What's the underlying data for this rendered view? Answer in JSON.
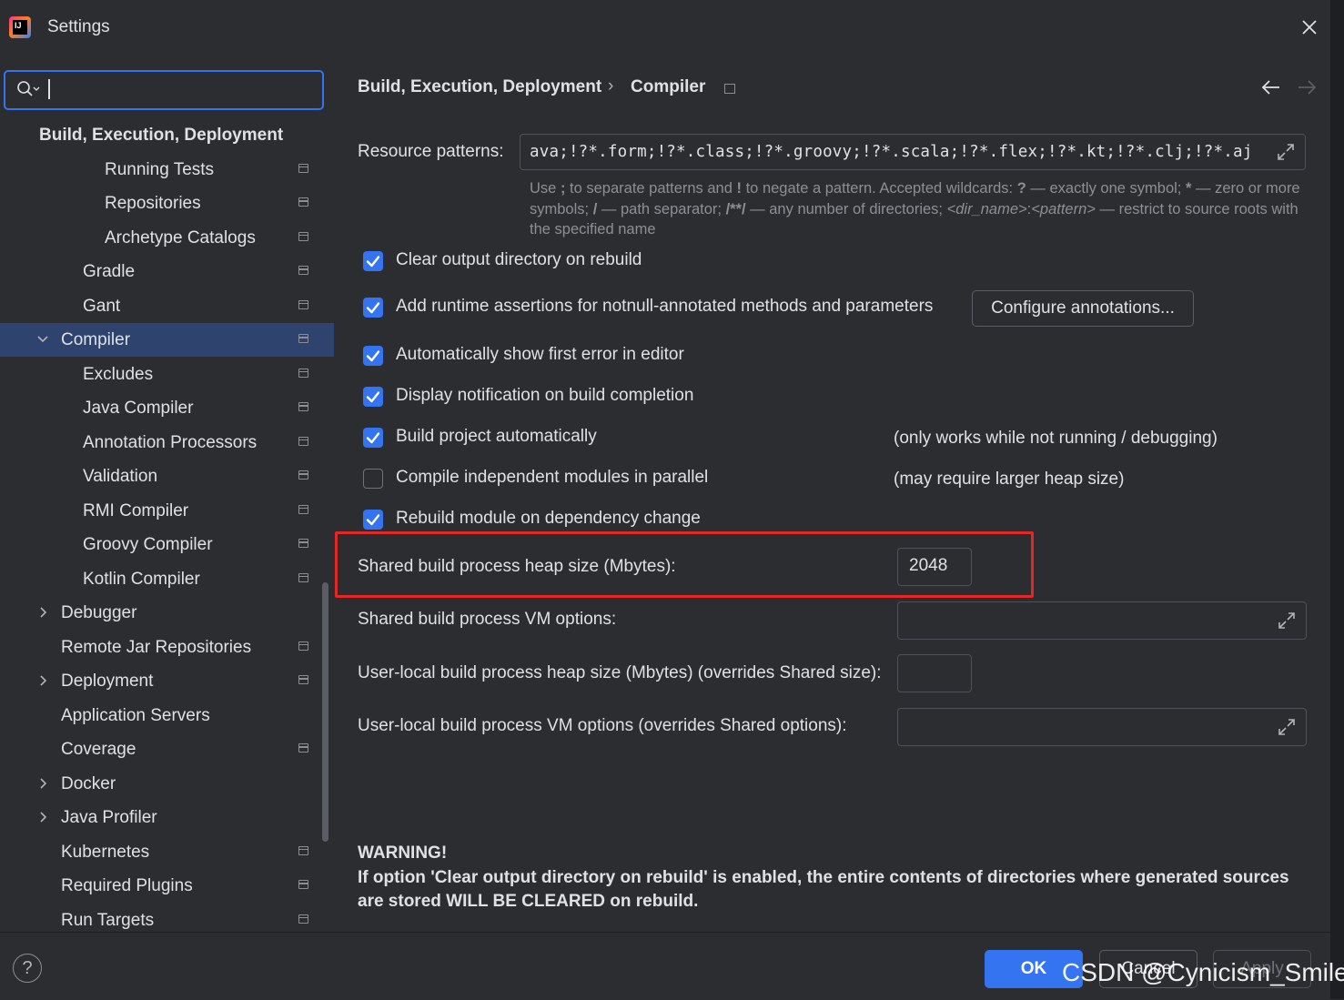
{
  "window": {
    "title": "Settings",
    "icons": {
      "app": "intellij-logo-icon",
      "close": "close-icon"
    }
  },
  "sidebar": {
    "search": {
      "value": "",
      "icon": "search-icon"
    },
    "items": [
      {
        "label": "Build, Execution, Deployment",
        "level": 0,
        "header": true
      },
      {
        "label": "Running Tests",
        "level": 3,
        "page_icon": true
      },
      {
        "label": "Repositories",
        "level": 3,
        "page_icon": true
      },
      {
        "label": "Archetype Catalogs",
        "level": 3,
        "page_icon": true
      },
      {
        "label": "Gradle",
        "level": 2,
        "page_icon": true
      },
      {
        "label": "Gant",
        "level": 2,
        "page_icon": true
      },
      {
        "label": "Compiler",
        "level": 1,
        "expanded": true,
        "selected": true,
        "page_icon": true
      },
      {
        "label": "Excludes",
        "level": 2,
        "page_icon": true
      },
      {
        "label": "Java Compiler",
        "level": 2,
        "page_icon": true
      },
      {
        "label": "Annotation Processors",
        "level": 2,
        "page_icon": true
      },
      {
        "label": "Validation",
        "level": 2,
        "page_icon": true
      },
      {
        "label": "RMI Compiler",
        "level": 2,
        "page_icon": true
      },
      {
        "label": "Groovy Compiler",
        "level": 2,
        "page_icon": true
      },
      {
        "label": "Kotlin Compiler",
        "level": 2,
        "page_icon": true
      },
      {
        "label": "Debugger",
        "level": 1,
        "collapsed": true
      },
      {
        "label": "Remote Jar Repositories",
        "level": 1,
        "page_icon": true
      },
      {
        "label": "Deployment",
        "level": 1,
        "collapsed": true,
        "page_icon": true
      },
      {
        "label": "Application Servers",
        "level": 1
      },
      {
        "label": "Coverage",
        "level": 1,
        "page_icon": true
      },
      {
        "label": "Docker",
        "level": 1,
        "collapsed": true
      },
      {
        "label": "Java Profiler",
        "level": 1,
        "collapsed": true
      },
      {
        "label": "Kubernetes",
        "level": 1,
        "page_icon": true
      },
      {
        "label": "Required Plugins",
        "level": 1,
        "page_icon": true
      },
      {
        "label": "Run Targets",
        "level": 1,
        "page_icon": true
      }
    ]
  },
  "breadcrumb": {
    "parent": "Build, Execution, Deployment",
    "separator": "›",
    "current": "Compiler",
    "back_icon": "arrow-left-icon",
    "forward_icon": "arrow-right-icon"
  },
  "resource_patterns": {
    "label": "Resource patterns:",
    "value": "ava;!?*.form;!?*.class;!?*.groovy;!?*.scala;!?*.flex;!?*.kt;!?*.clj;!?*.aj",
    "help_1": "Use",
    "help_2": ";",
    "help_3": "to separate patterns and",
    "help_4": "!",
    "help_5": "to negate a pattern. Accepted wildcards:",
    "help_6": "?",
    "help_7": "— exactly one symbol;",
    "help_8": "*",
    "help_9": "— zero or more symbols;",
    "help_10": "/",
    "help_11": "— path separator;",
    "help_12": "/**/",
    "help_13": "— any number of directories;",
    "help_14": "<dir_name>",
    "help_15": ":",
    "help_16": "<pattern>",
    "help_17": "— restrict to source roots with the specified name"
  },
  "options": [
    {
      "label": "Clear output directory on rebuild",
      "checked": true
    },
    {
      "label": "Add runtime assertions for notnull-annotated methods and parameters",
      "checked": true
    },
    {
      "label": "Automatically show first error in editor",
      "checked": true
    },
    {
      "label": "Display notification on build completion",
      "checked": true
    },
    {
      "label": "Build project automatically",
      "checked": true,
      "note": "(only works while not running / debugging)"
    },
    {
      "label": "Compile independent modules in parallel",
      "checked": false,
      "note": "(may require larger heap size)"
    },
    {
      "label": "Rebuild module on dependency change",
      "checked": true
    }
  ],
  "configure_annotations_label": "Configure annotations...",
  "fields": {
    "shared_heap": {
      "label": "Shared build process heap size (Mbytes):",
      "value": "2048"
    },
    "shared_vm": {
      "label": "Shared build process VM options:",
      "value": ""
    },
    "user_heap": {
      "label": "User-local build process heap size (Mbytes) (overrides Shared size):",
      "value": ""
    },
    "user_vm": {
      "label": "User-local build process VM options (overrides Shared options):",
      "value": ""
    }
  },
  "warning": {
    "title": "WARNING!",
    "text": "If option 'Clear output directory on rebuild' is enabled, the entire contents of directories where generated sources are stored WILL BE CLEARED on rebuild."
  },
  "footer": {
    "help": "?",
    "ok": "OK",
    "cancel": "Cancel",
    "apply": "Apply",
    "watermark": "CSDN @Cynicism_Smile"
  },
  "colors": {
    "background": "#2b2d30",
    "accent": "#3574f0",
    "selected_row": "#2e436e",
    "highlight_border": "#e32626"
  }
}
